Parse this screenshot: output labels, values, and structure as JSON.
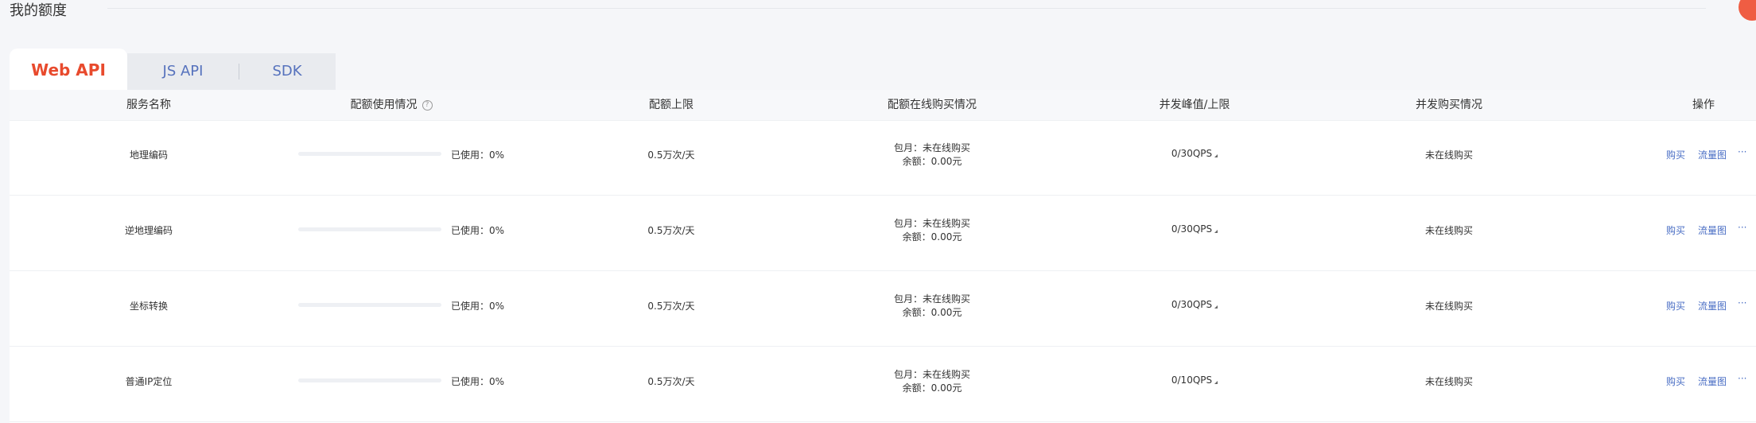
{
  "page": {
    "title": "我的额度"
  },
  "tabs": [
    {
      "label": "Web API",
      "active": true
    },
    {
      "label": "JS API",
      "active": false
    },
    {
      "label": "SDK",
      "active": false
    }
  ],
  "table": {
    "headers": {
      "service": "服务名称",
      "usage": "配额使用情况",
      "limit": "配额上限",
      "purchase": "配额在线购买情况",
      "concurrency": "并发峰值/上限",
      "concurrency_purchase": "并发购买情况",
      "actions": "操作"
    },
    "help_icon": "question-icon",
    "rows": [
      {
        "name": "地理编码",
        "usage_text": "已使用：0%",
        "usage_fraction": 0,
        "limit": "0.5万次/天",
        "monthly": "包月：未在线购买",
        "balance": "余额：0.00元",
        "qps": "0/30QPS",
        "concurrency_purchase": "未在线购买",
        "buy": "购买",
        "traffic": "流量图",
        "more": "···"
      },
      {
        "name": "逆地理编码",
        "usage_text": "已使用：0%",
        "usage_fraction": 0,
        "limit": "0.5万次/天",
        "monthly": "包月：未在线购买",
        "balance": "余额：0.00元",
        "qps": "0/30QPS",
        "concurrency_purchase": "未在线购买",
        "buy": "购买",
        "traffic": "流量图",
        "more": "···"
      },
      {
        "name": "坐标转换",
        "usage_text": "已使用：0%",
        "usage_fraction": 0,
        "limit": "0.5万次/天",
        "monthly": "包月：未在线购买",
        "balance": "余额：0.00元",
        "qps": "0/30QPS",
        "concurrency_purchase": "未在线购买",
        "buy": "购买",
        "traffic": "流量图",
        "more": "···"
      },
      {
        "name": "普通IP定位",
        "usage_text": "已使用：0%",
        "usage_fraction": 0,
        "limit": "0.5万次/天",
        "monthly": "包月：未在线购买",
        "balance": "余额：0.00元",
        "qps": "0/10QPS",
        "concurrency_purchase": "未在线购买",
        "buy": "购买",
        "traffic": "流量图",
        "more": "···"
      }
    ]
  },
  "colors": {
    "accent": "#e84a2d",
    "link": "#4a6ec4"
  }
}
